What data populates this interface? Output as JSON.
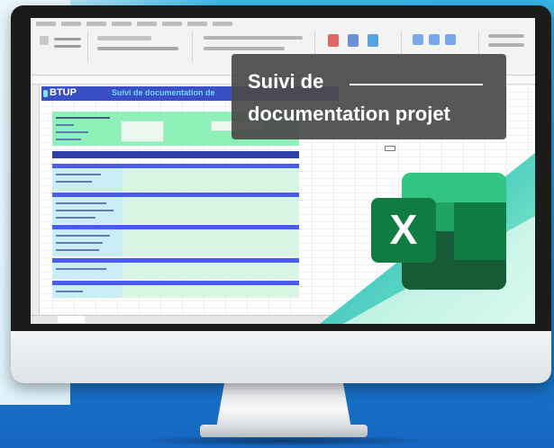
{
  "screen": {
    "spreadsheet": {
      "logo": "BTUP",
      "header_title": "Suivi de documentation de"
    },
    "overlay": {
      "title_line1": "Suivi de",
      "title_line2": "documentation projet"
    },
    "app_icon": {
      "name": "excel-icon",
      "letter": "X"
    }
  },
  "colors": {
    "background_blue": "#1f8fd6",
    "excel_green": "#1e7145",
    "header_band": "#3a4fc6",
    "section_bar": "#4a5cf0",
    "overlay_bg": "#4a4a4a"
  }
}
